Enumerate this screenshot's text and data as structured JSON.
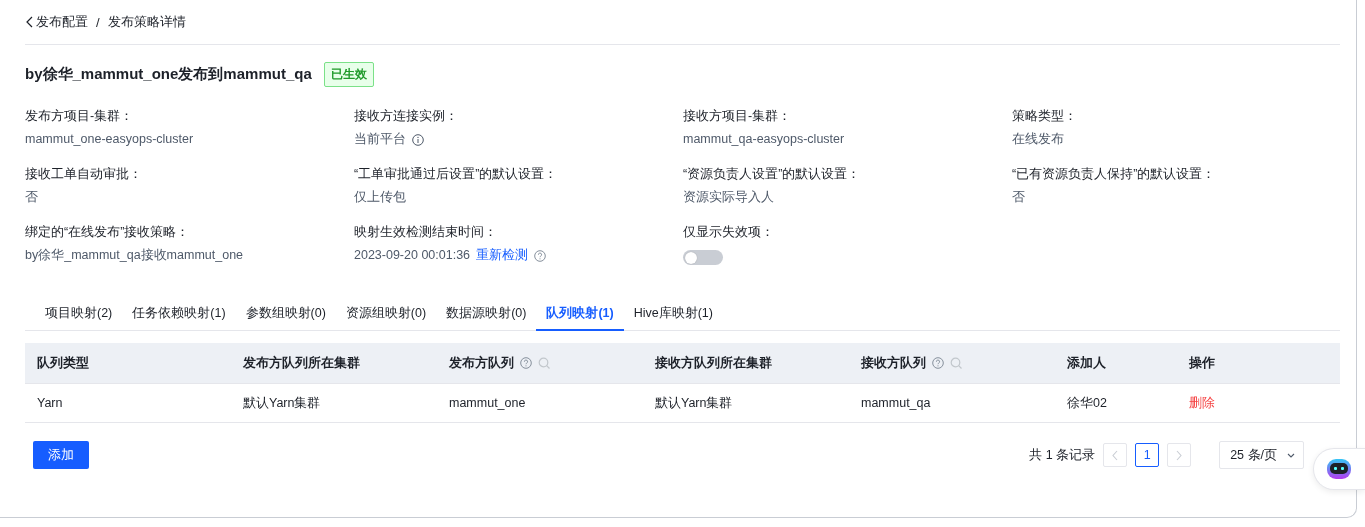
{
  "breadcrumb": {
    "back": "发布配置",
    "separator": "/",
    "current": "发布策略详情"
  },
  "title": "by徐华_mammut_one发布到mammut_qa",
  "status_badge": "已生效",
  "fields": [
    {
      "kind": "text",
      "label": "发布方项目-集群：",
      "value": "mammut_one-easyops-cluster"
    },
    {
      "kind": "info",
      "label": "接收方连接实例：",
      "value": "当前平台"
    },
    {
      "kind": "text",
      "label": "接收方项目-集群：",
      "value": "mammut_qa-easyops-cluster"
    },
    {
      "kind": "text",
      "label": "策略类型：",
      "value": "在线发布"
    },
    {
      "kind": "text",
      "label": "接收工单自动审批：",
      "value": "否"
    },
    {
      "kind": "text",
      "label": "“工单审批通过后设置”的默认设置：",
      "value": "仅上传包"
    },
    {
      "kind": "text",
      "label": "“资源负责人设置”的默认设置：",
      "value": "资源实际导入人"
    },
    {
      "kind": "text",
      "label": "“已有资源负责人保持”的默认设置：",
      "value": "否"
    },
    {
      "kind": "text",
      "label": "绑定的“在线发布”接收策略：",
      "value": "by徐华_mammut_qa接收mammut_one"
    },
    {
      "kind": "recheck",
      "label": "映射生效检测结束时间：",
      "value": "2023-09-20 00:01:36",
      "link": "重新检测"
    },
    {
      "kind": "switch",
      "label": "仅显示失效项：",
      "on": false
    }
  ],
  "tabs": [
    {
      "label": "项目映射(2)",
      "selected": false
    },
    {
      "label": "任务依赖映射(1)",
      "selected": false
    },
    {
      "label": "参数组映射(0)",
      "selected": false
    },
    {
      "label": "资源组映射(0)",
      "selected": false
    },
    {
      "label": "数据源映射(0)",
      "selected": false
    },
    {
      "label": "队列映射(1)",
      "selected": true
    },
    {
      "label": "Hive库映射(1)",
      "selected": false
    }
  ],
  "table": {
    "columns": [
      {
        "label": "队列类型"
      },
      {
        "label": "发布方队列所在集群"
      },
      {
        "label": "发布方队列",
        "icons": [
          {
            "kind": "help"
          },
          {
            "kind": "search"
          }
        ]
      },
      {
        "label": "接收方队列所在集群"
      },
      {
        "label": "接收方队列",
        "icons": [
          {
            "kind": "help"
          },
          {
            "kind": "search"
          }
        ]
      },
      {
        "label": "添加人"
      },
      {
        "label": "操作"
      }
    ],
    "rows": [
      {
        "cells": [
          "Yarn",
          "默认Yarn集群",
          "mammut_one",
          "默认Yarn集群",
          "mammut_qa",
          "徐华02"
        ],
        "action": "删除"
      }
    ]
  },
  "add_button": "添加",
  "pagination": {
    "total": "共 1 条记录",
    "pages": [
      {
        "label": "1",
        "selected": true
      }
    ],
    "page_size": "25 条/页"
  }
}
